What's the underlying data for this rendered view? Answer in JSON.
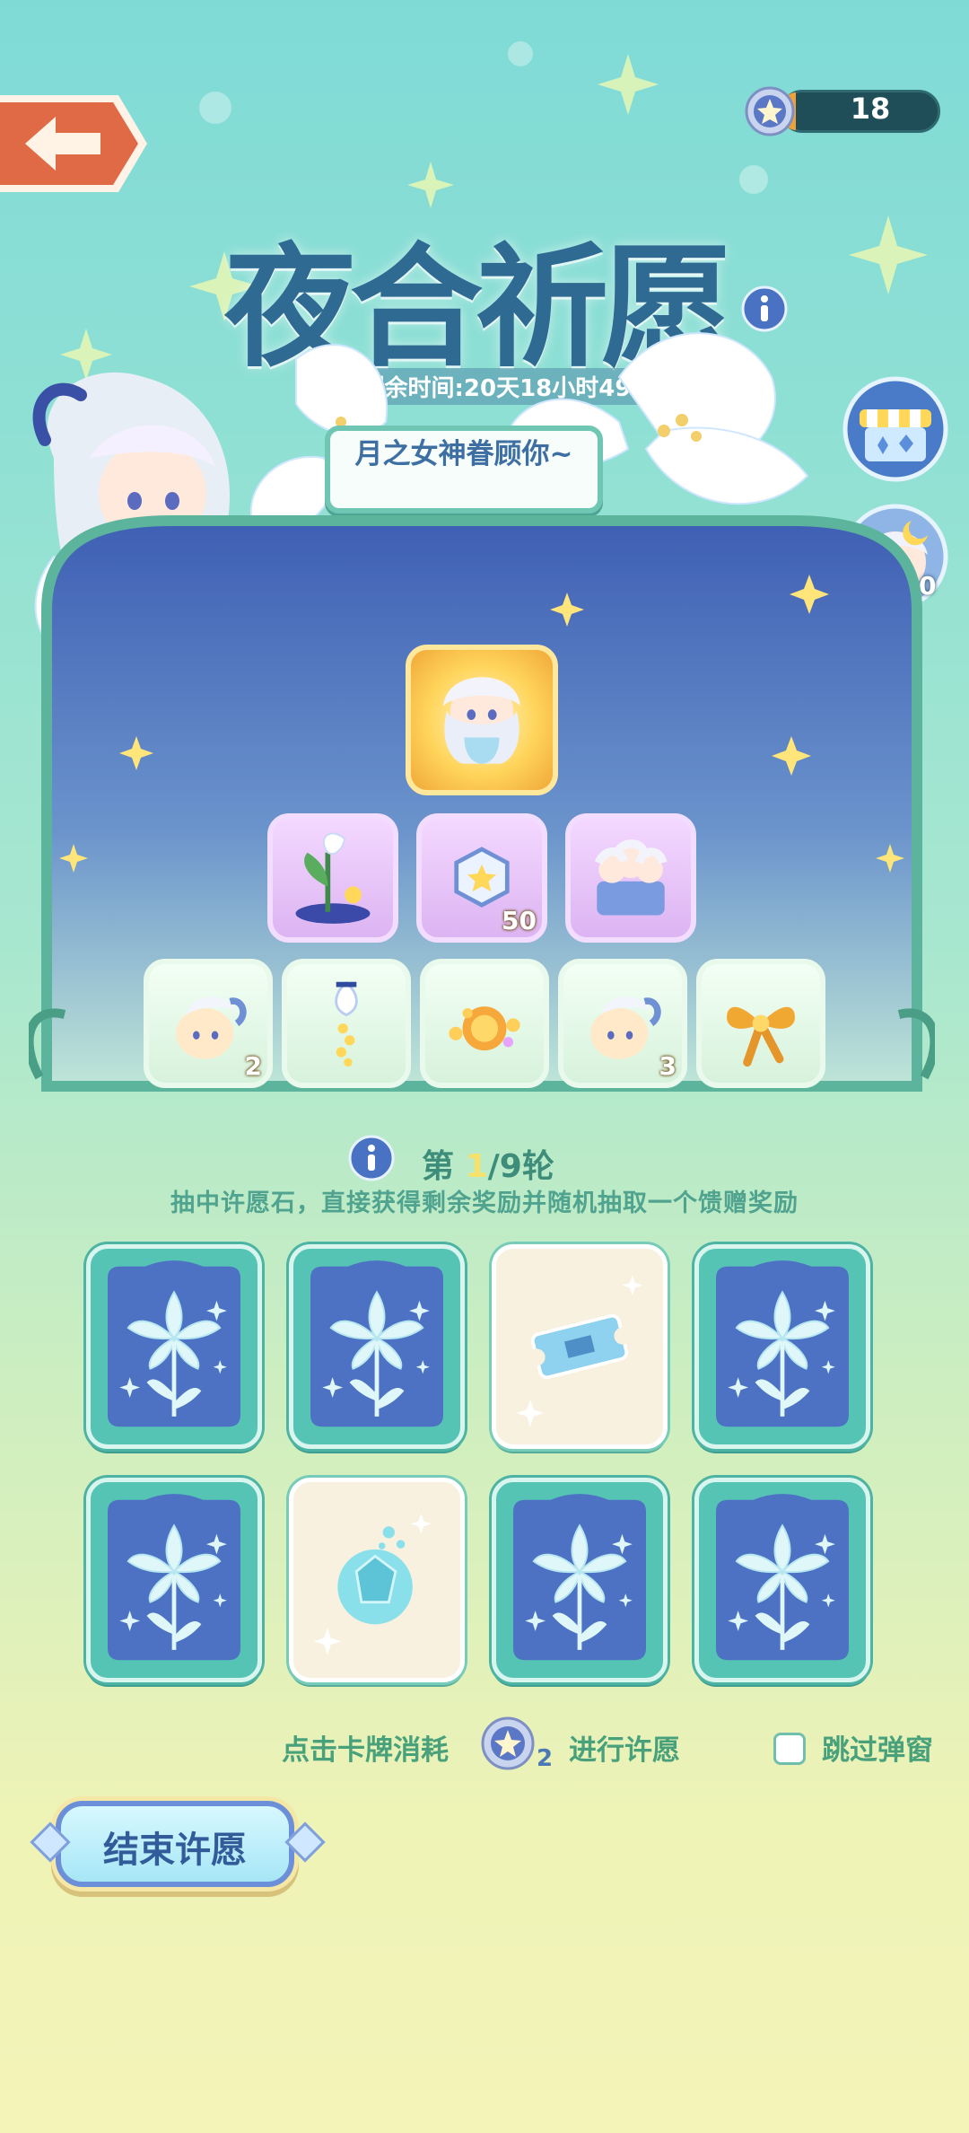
{
  "header": {
    "back_icon": "arrow-left-icon",
    "currency_icon": "star-coin-icon",
    "currency_value": "18"
  },
  "event": {
    "title": "夜合祈愿",
    "timer": "活动剩余时间:20天18小时49分",
    "slogan": "月之女神眷顾你~"
  },
  "side": {
    "shop_icon": "shop-icon",
    "character_count": "0"
  },
  "prizes": {
    "grand": {
      "name": "goddess-avatar-frame",
      "count": ""
    },
    "row2": [
      {
        "name": "lily-plant",
        "count": ""
      },
      {
        "name": "star-badge",
        "count": "50"
      },
      {
        "name": "figure-cake",
        "count": ""
      }
    ],
    "row3": [
      {
        "name": "moon-egg",
        "count": "2"
      },
      {
        "name": "lily-pendant",
        "count": ""
      },
      {
        "name": "golden-charm",
        "count": ""
      },
      {
        "name": "moon-egg",
        "count": "3"
      },
      {
        "name": "golden-bow",
        "count": ""
      }
    ]
  },
  "round": {
    "prefix": "第",
    "current": "1",
    "suffix": "/9轮",
    "rule": "抽中许愿石，直接获得剩余奖励并随机抽取一个馈赠奖励"
  },
  "cards": [
    {
      "state": "back"
    },
    {
      "state": "back"
    },
    {
      "state": "revealed",
      "item": "ticket"
    },
    {
      "state": "back"
    },
    {
      "state": "back"
    },
    {
      "state": "revealed",
      "item": "wish-stone"
    },
    {
      "state": "back"
    },
    {
      "state": "back"
    }
  ],
  "wish": {
    "left_text": "点击卡牌消耗",
    "cost": "2",
    "right_text": "进行许愿",
    "skip_label": "跳过弹窗",
    "skip_checked": false
  },
  "end_button": {
    "label": "结束许愿"
  },
  "colors": {
    "teal": "#56c4b4",
    "title_blue": "#2f6a93",
    "text_green": "#49a17c",
    "night_blue": "#4d72c4"
  }
}
